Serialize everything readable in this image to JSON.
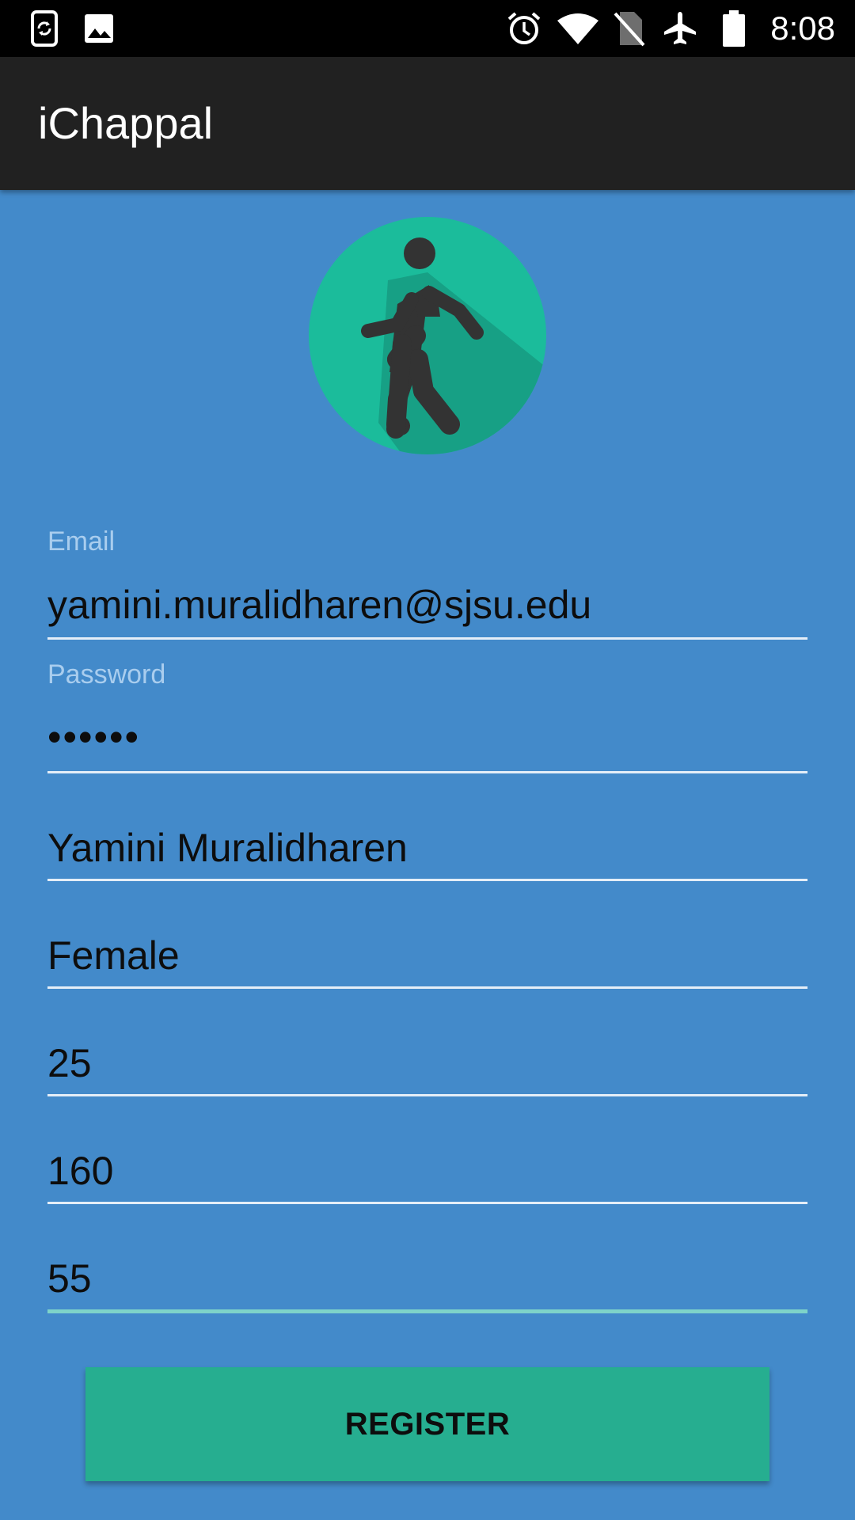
{
  "status_bar": {
    "time": "8:08",
    "icons": [
      "screen-rotation-icon",
      "image-icon",
      "alarm-icon",
      "wifi-icon",
      "no-sim-icon",
      "airplane-icon",
      "battery-icon"
    ]
  },
  "app_bar": {
    "title": "iChappal"
  },
  "logo": {
    "icon": "walking-person-icon",
    "circle_color": "#1BBC9B",
    "figure_color": "#333333"
  },
  "form": {
    "email": {
      "label": "Email",
      "value": "yamini.muralidharen@sjsu.edu"
    },
    "password": {
      "label": "Password",
      "value": "••••••"
    },
    "name": {
      "value": "Yamini Muralidharen"
    },
    "gender": {
      "value": "Female"
    },
    "age": {
      "value": "25"
    },
    "height": {
      "value": "160"
    },
    "weight": {
      "value": "55"
    }
  },
  "register_button": {
    "label": "REGISTER"
  },
  "colors": {
    "background": "#438ACA",
    "app_bar": "#212121",
    "accent": "#26AE90",
    "focus_underline": "#7ED3C9"
  }
}
